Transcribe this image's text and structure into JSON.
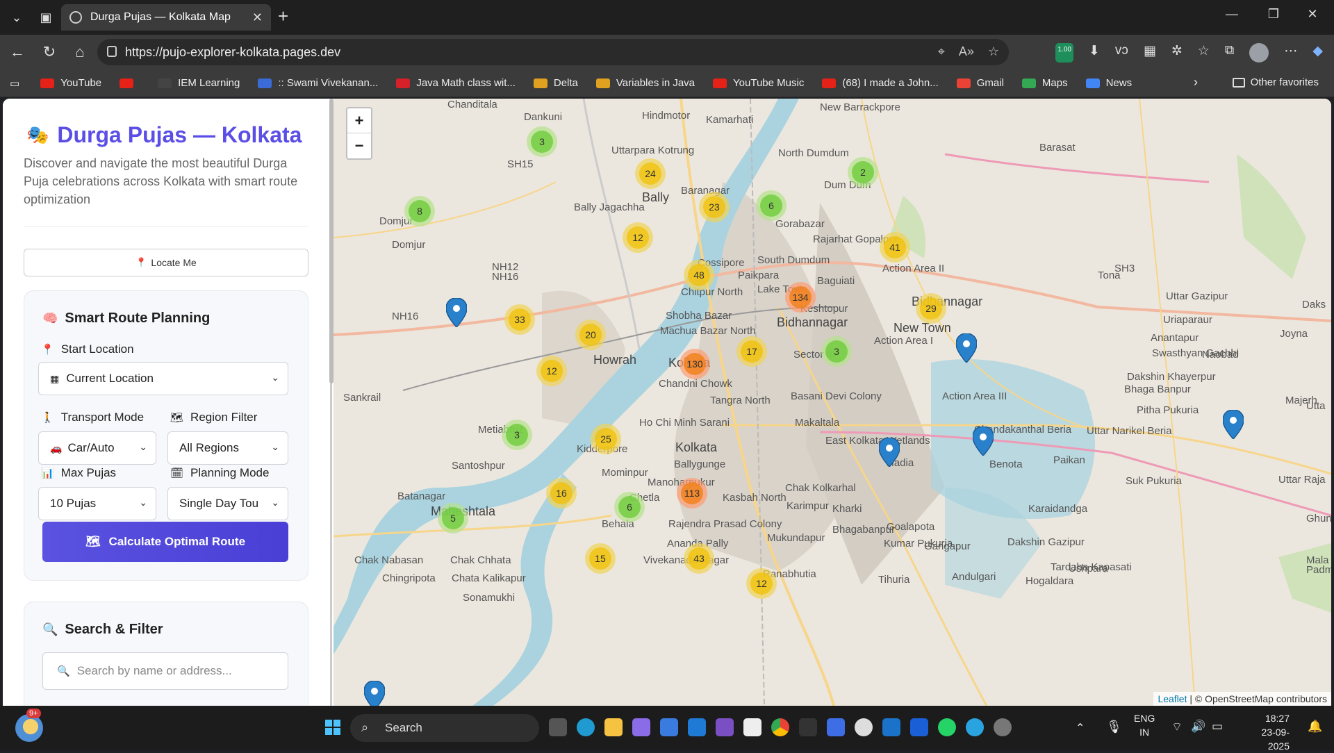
{
  "browser": {
    "tab_title": "Durga Pujas — Kolkata Map",
    "url": "https://pujo-explorer-kolkata.pages.dev",
    "bookmarks": [
      {
        "label": "YouTube",
        "color": "#e62117"
      },
      {
        "label": "",
        "color": "#e62117"
      },
      {
        "label": "IEM Learning",
        "color": "#444444"
      },
      {
        "label": ":: Swami Vivekanan...",
        "color": "#3b6bd6"
      },
      {
        "label": "Java Math class wit...",
        "color": "#d6202a"
      },
      {
        "label": "Delta",
        "color": "#e0a020"
      },
      {
        "label": "Variables in Java",
        "color": "#e0a020"
      },
      {
        "label": "YouTube Music",
        "color": "#e62117"
      },
      {
        "label": "(68) I made a John...",
        "color": "#e62117"
      },
      {
        "label": "Gmail",
        "color": "#ea4335"
      },
      {
        "label": "Maps",
        "color": "#34a853"
      },
      {
        "label": "News",
        "color": "#4285f4"
      }
    ],
    "other_favorites": "Other favorites",
    "extension_badge": "1.00"
  },
  "sidebar": {
    "title": "Durga Pujas — Kolkata",
    "description": "Discover and navigate the most beautiful Durga Puja celebrations across Kolkata with smart route optimization",
    "locate_me": "Locate Me",
    "route_card": {
      "heading": "Smart Route Planning",
      "start_label": "Start Location",
      "start_value": "Current Location",
      "transport_label": "Transport Mode",
      "transport_value": "Car/Auto",
      "region_label": "Region Filter",
      "region_value": "All Regions",
      "max_label": "Max Pujas",
      "max_value": "10 Pujas",
      "planning_label": "Planning Mode",
      "planning_value": "Single Day Tou",
      "cta": "Calculate Optimal Route"
    },
    "search_card": {
      "heading": "Search & Filter",
      "placeholder": "Search by name or address..."
    }
  },
  "map": {
    "zoom_in": "+",
    "zoom_out": "−",
    "attribution_leaflet": "Leaflet",
    "attribution_osm": "| © OpenStreetMap contributors",
    "clusters": [
      {
        "count": "3",
        "level": "green"
      },
      {
        "count": "24",
        "level": "yellow"
      },
      {
        "count": "2",
        "level": "green"
      },
      {
        "count": "8",
        "level": "green"
      },
      {
        "count": "23",
        "level": "yellow"
      },
      {
        "count": "6",
        "level": "green"
      },
      {
        "count": "12",
        "level": "yellow"
      },
      {
        "count": "41",
        "level": "yellow"
      },
      {
        "count": "48",
        "level": "yellow"
      },
      {
        "count": "134",
        "level": "orange"
      },
      {
        "count": "29",
        "level": "yellow"
      },
      {
        "count": "33",
        "level": "yellow"
      },
      {
        "count": "20",
        "level": "yellow"
      },
      {
        "count": "17",
        "level": "yellow"
      },
      {
        "count": "3",
        "level": "green"
      },
      {
        "count": "12",
        "level": "yellow"
      },
      {
        "count": "130",
        "level": "orange"
      },
      {
        "count": "3",
        "level": "green"
      },
      {
        "count": "25",
        "level": "yellow"
      },
      {
        "count": "16",
        "level": "yellow"
      },
      {
        "count": "6",
        "level": "green"
      },
      {
        "count": "113",
        "level": "orange"
      },
      {
        "count": "5",
        "level": "green"
      },
      {
        "count": "15",
        "level": "yellow"
      },
      {
        "count": "43",
        "level": "yellow"
      },
      {
        "count": "12",
        "level": "yellow"
      }
    ],
    "labels": [
      "Chanditala",
      "Dankuni",
      "Hindmotor",
      "Kamarhati",
      "New Barrackpore",
      "Uttarpara Kotrung",
      "North Dumdum",
      "Barasat",
      "Dum Dum",
      "SH15",
      "Baranagar",
      "Bally",
      "Bally Jagachha",
      "Domjur",
      "Gorabazar",
      "Rajarhat Gopalpur",
      "Action Area II",
      "SH3",
      "Tona",
      "Uttar Gazipur",
      "Domjur",
      "South Dumdum",
      "Cossipore",
      "Paikpara",
      "Baguiati",
      "Bidhannagar",
      "NH12",
      "NH16",
      "Chitpur North",
      "Lake Town",
      "Keshtopur",
      "Uriaparaur",
      "NH16",
      "Shobha Bazar",
      "New Town",
      "Anantapur",
      "Machua Bazar North",
      "Bidhannagar",
      "Action Area I",
      "Swasthyan Gachhi",
      "Naobad",
      "Howrah",
      "Kolkata",
      "Sector III",
      "Dakshin Khayerpur",
      "Bhaga Banpur",
      "Sankrail",
      "Chandni Chowk",
      "Tangra North",
      "Basani Devi Colony",
      "Action Area III",
      "Pitha Pukuria",
      "Ho Chi Minh Sarani",
      "Makaltala",
      "Chandakanthal Beria",
      "Uttar Narikel Beria",
      "Metiabruz",
      "Kolkata",
      "East Kolkata Wetlands",
      "Santoshpur",
      "Kidderpore",
      "Ballygunge",
      "Hadia",
      "Benota",
      "Paikan",
      "Mominpur",
      "Suk Pukuria",
      "Uttar Raja",
      "Manoharpukur",
      "Batanagar",
      "Chetla",
      "Kasbah North",
      "Chak Kolkarhal",
      "Maheshtala",
      "Karimpur",
      "Kharki",
      "Karaidandga",
      "Ghunimeghi",
      "Behala",
      "Rajendra Prasad Colony",
      "Bhagabanpur",
      "Goalapota",
      "Kumar Pukuria",
      "Dakshin Gazipur",
      "Mukundapur",
      "Ananda Pally",
      "Gangapur",
      "Chak Nabasan",
      "Chak Chhata",
      "Vivekanada Nagar",
      "Tardaha Kapasati",
      "Ushpara",
      "Ranabhutia",
      "Padma Puk",
      "Chingripota",
      "Chata Kalikapur",
      "Andulgari",
      "Hogaldara",
      "Tihuria",
      "Sonamukhi",
      "Joyna",
      "Majerh",
      "Utta",
      "Daks",
      "Mala"
    ]
  },
  "taskbar": {
    "weather_badge": "9+",
    "search": "Search",
    "lang_1": "ENG",
    "lang_2": "IN",
    "time": "18:27",
    "date": "23-09-2025"
  }
}
